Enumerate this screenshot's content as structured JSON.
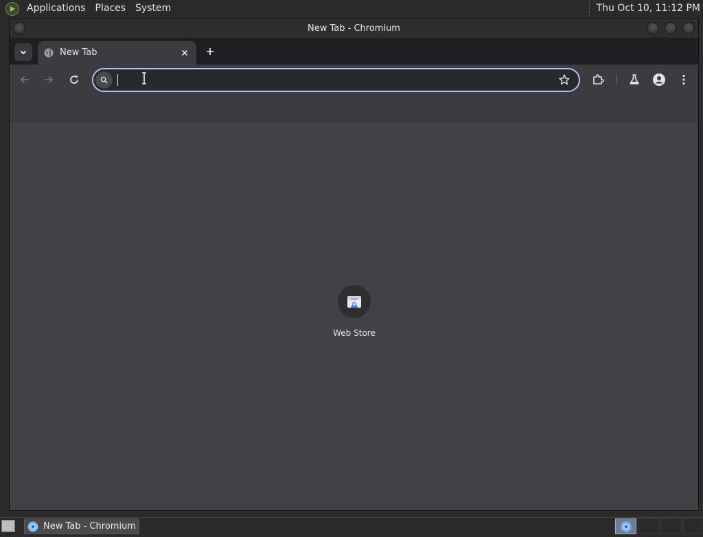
{
  "top_panel": {
    "menus": [
      "Applications",
      "Places",
      "System"
    ],
    "clock": "Thu Oct 10, 11:12 PM"
  },
  "window": {
    "title": "New Tab - Chromium"
  },
  "tabs": [
    {
      "label": "New Tab",
      "icon": "globe-icon",
      "active": true
    }
  ],
  "omnibox": {
    "value": "",
    "placeholder": ""
  },
  "shortcuts": [
    {
      "name": "Web Store",
      "icon": "web-store-icon"
    }
  ],
  "taskbar": {
    "window_label": "New Tab - Chromium"
  },
  "colors": {
    "accent": "#a8c7fa",
    "toolbar": "#3c3c40",
    "content_bg": "#414146",
    "tabstrip": "#1e1f22"
  }
}
